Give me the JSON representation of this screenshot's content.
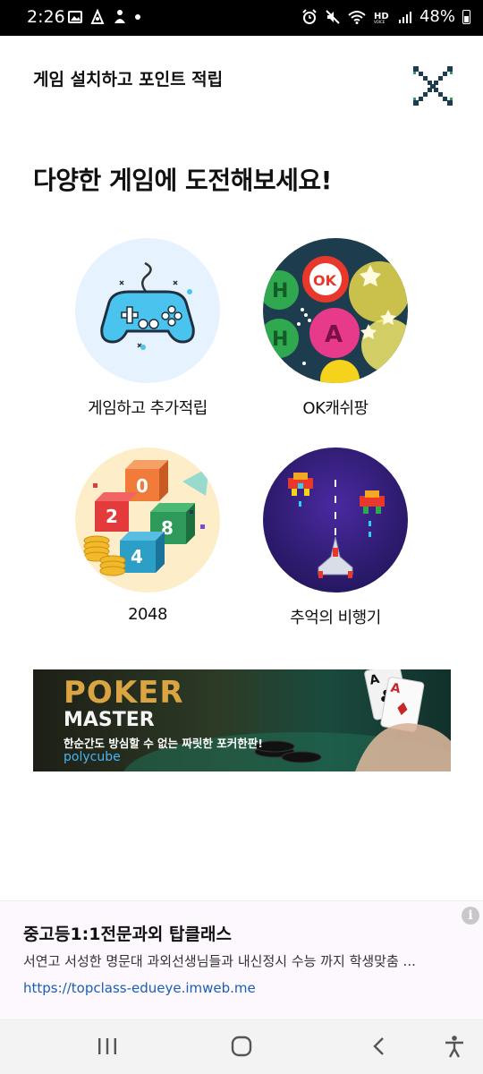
{
  "status_bar": {
    "time": "2:26",
    "left_icons": [
      "image-icon",
      "app-icon",
      "app-icon-2",
      "dot-icon"
    ],
    "right_icons": [
      "alarm-icon",
      "mute-icon",
      "wifi-icon",
      "hd-voice-icon",
      "signal-icon"
    ],
    "battery": "48%"
  },
  "header": {
    "title": "게임 설치하고 포인트 적립"
  },
  "headline": "다양한 게임에 도전해보세요!",
  "games": [
    {
      "label": "게임하고 추가적립",
      "icon": "gamepad-icon"
    },
    {
      "label": "OK캐쉬팡",
      "icon": "puzzle-balls-icon"
    },
    {
      "label": "2048",
      "icon": "number-blocks-icon"
    },
    {
      "label": "추억의 비행기",
      "icon": "spaceship-icon"
    }
  ],
  "banner": {
    "title_line1": "POKER",
    "title_line2": "MASTER",
    "tagline": "한순간도 방심할 수 없는 짜릿한 포커한판!",
    "brand": "polycube"
  },
  "ad": {
    "title": "중고등1:1전문과외 탑클래스",
    "description": "서연고 서성한 명문대 과외선생님들과 내신정시 수능 까지 학생맞춤 ...",
    "url": "https://topclass-edueye.imweb.me",
    "info_glyph": "i"
  },
  "colors": {
    "accent_green": "#2f9d5d",
    "dark_navy": "#1d3d4f",
    "ad_bg": "#fdf7fe",
    "link_blue": "#1a5fb4"
  }
}
